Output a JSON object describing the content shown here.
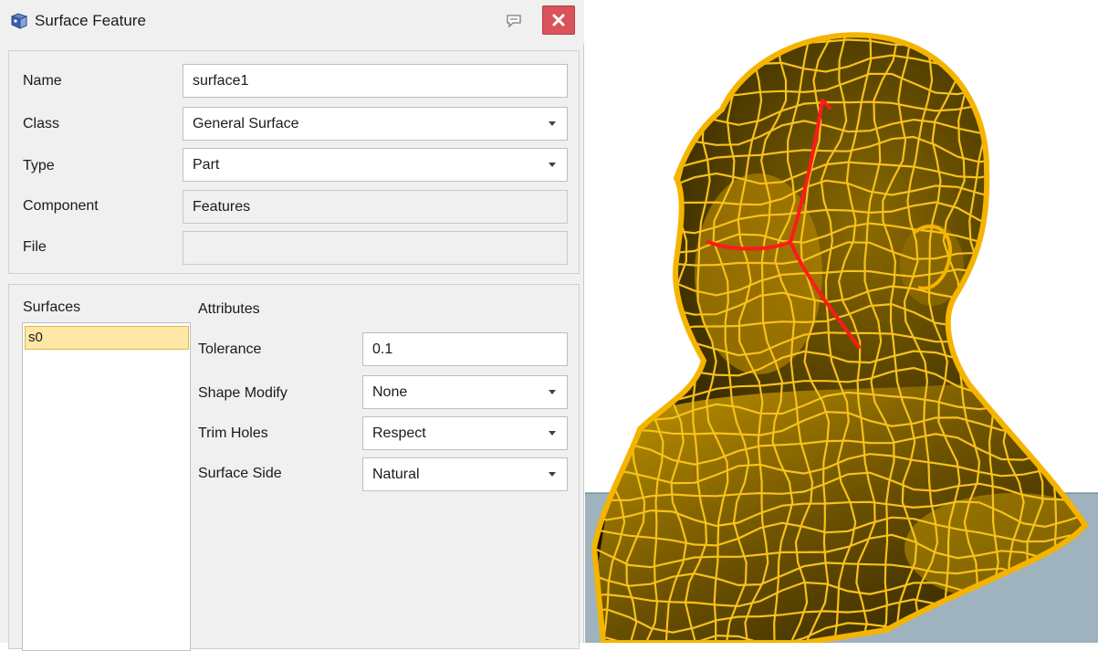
{
  "dialog": {
    "title": "Surface Feature",
    "icons": {
      "app": "surface-feature-icon",
      "pin": "comment-pin-icon",
      "close": "close-icon"
    },
    "colors": {
      "close_button": "#d9535b",
      "selection": "#ffe8a6"
    }
  },
  "properties": {
    "name": {
      "label": "Name",
      "value": "surface1"
    },
    "class": {
      "label": "Class",
      "value": "General Surface"
    },
    "type": {
      "label": "Type",
      "value": "Part"
    },
    "component": {
      "label": "Component",
      "value": "Features"
    },
    "file": {
      "label": "File",
      "value": ""
    }
  },
  "surfaces": {
    "header": "Surfaces",
    "items": [
      "s0"
    ]
  },
  "attributes": {
    "header": "Attributes",
    "tolerance": {
      "label": "Tolerance",
      "value": "0.1"
    },
    "shape_modify": {
      "label": "Shape Modify",
      "value": "None"
    },
    "trim_holes": {
      "label": "Trim Holes",
      "value": "Respect"
    },
    "surface_side": {
      "label": "Surface Side",
      "value": "Natural"
    }
  },
  "viewport": {
    "model": "head-bust-wireframe",
    "colors": {
      "mesh": "#f5b400",
      "mesh_lines": "#f7c21a",
      "shading": "#2b2200",
      "highlight_curve": "#ff1a1a",
      "ground": "#9fb3be"
    }
  }
}
